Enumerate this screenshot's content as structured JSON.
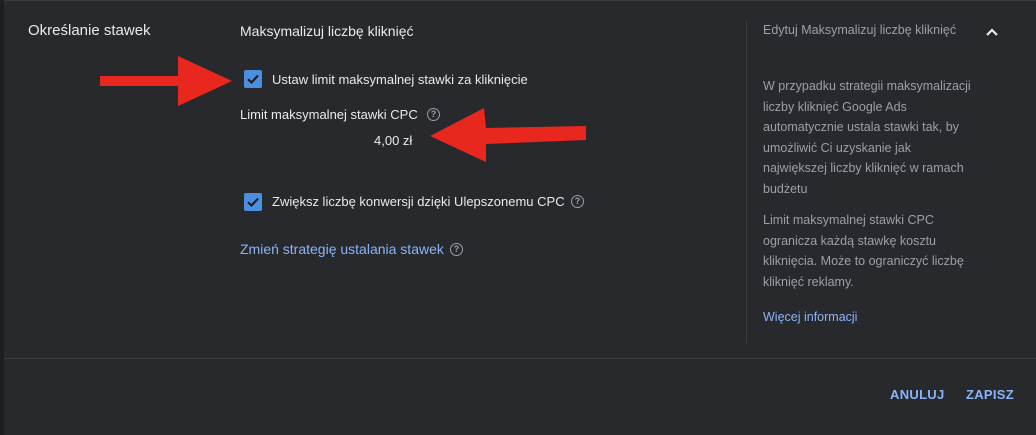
{
  "section": {
    "label": "Określanie stawek"
  },
  "strategy": {
    "title": "Maksymalizuj liczbę kliknięć",
    "max_cpc_checkbox": {
      "label": "Ustaw limit maksymalnej stawki za kliknięcie",
      "checked": true
    },
    "limit_label": "Limit maksymalnej stawki CPC",
    "limit_value": "4,00 zł",
    "enhanced_cpc_checkbox": {
      "label": "Zwiększ liczbę konwersji dzięki Ulepszonemu CPC",
      "checked": true
    },
    "change_link": "Zmień strategię ustalania stawek"
  },
  "side_panel": {
    "title": "Edytuj Maksymalizuj liczbę kliknięć",
    "paragraph1": "W przypadku strategii maksymalizacji liczby kliknięć Google Ads automatycznie ustala stawki tak, by umożliwić Ci uzyskanie jak największej liczby kliknięć w ramach budżetu",
    "paragraph2": "Limit maksymalnej stawki CPC ogranicza każdą stawkę kosztu kliknięcia. Może to ograniczyć liczbę kliknięć reklamy.",
    "more_link": "Więcej informacji"
  },
  "footer": {
    "cancel_label": "ANULUJ",
    "save_label": "ZAPISZ"
  },
  "icons": {
    "help": "help-circle-icon",
    "collapse": "chevron-up-icon",
    "annotation": "red-arrow"
  },
  "colors": {
    "accent": "#8ab4f8",
    "checkbox": "#4a8fe0",
    "annotation": "#e8271e"
  }
}
